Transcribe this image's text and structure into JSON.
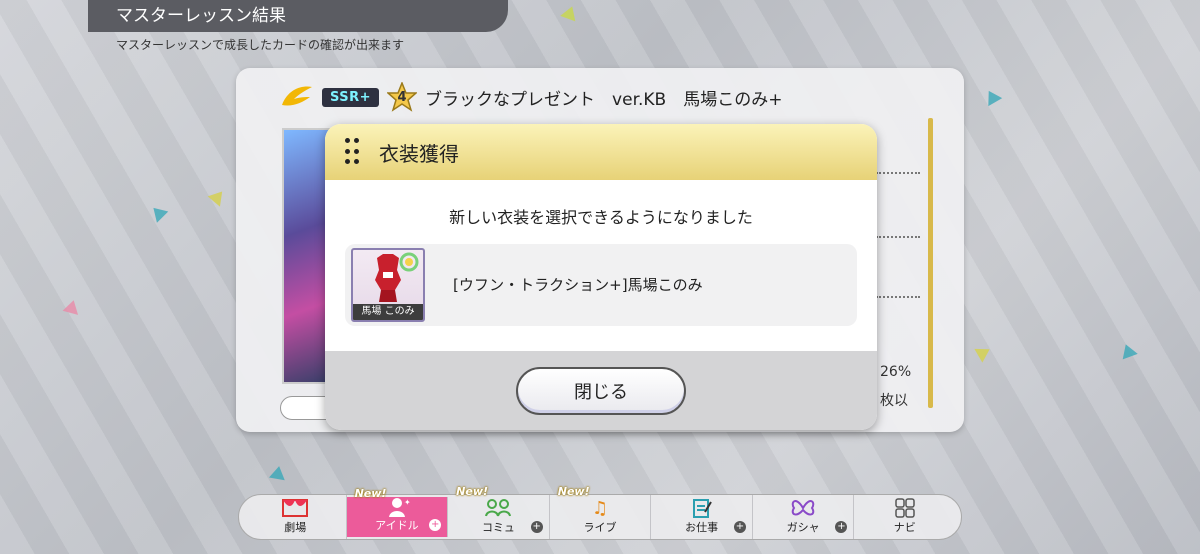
{
  "header": {
    "title": "マスターレッスン結果",
    "subtitle": "マスターレッスンで成長したカードの確認が出来ます"
  },
  "card": {
    "rarity": "SSR+",
    "rank": "4",
    "name": "ブラックなプレゼント　ver.KB　馬場このみ+",
    "right_texts": [
      "26%",
      "枚以"
    ]
  },
  "modal": {
    "title": "衣装獲得",
    "message": "新しい衣装を選択できるようになりました",
    "item_label": "[ウフン・トラクション+]馬場このみ",
    "thumb_name": "馬場 このみ",
    "close_label": "閉じる"
  },
  "nav": {
    "items": [
      {
        "label": "劇場",
        "new": ""
      },
      {
        "label": "アイドル",
        "new": "New!"
      },
      {
        "label": "コミュ",
        "new": "New!"
      },
      {
        "label": "ライブ",
        "new": "New!"
      },
      {
        "label": "お仕事",
        "new": ""
      },
      {
        "label": "ガシャ",
        "new": ""
      },
      {
        "label": "ナビ",
        "new": ""
      }
    ]
  },
  "colors": {
    "accent_pink": "#ec5b9a",
    "modal_header_gold": "#e7d277",
    "ssr_teal": "#7ef2ff"
  }
}
